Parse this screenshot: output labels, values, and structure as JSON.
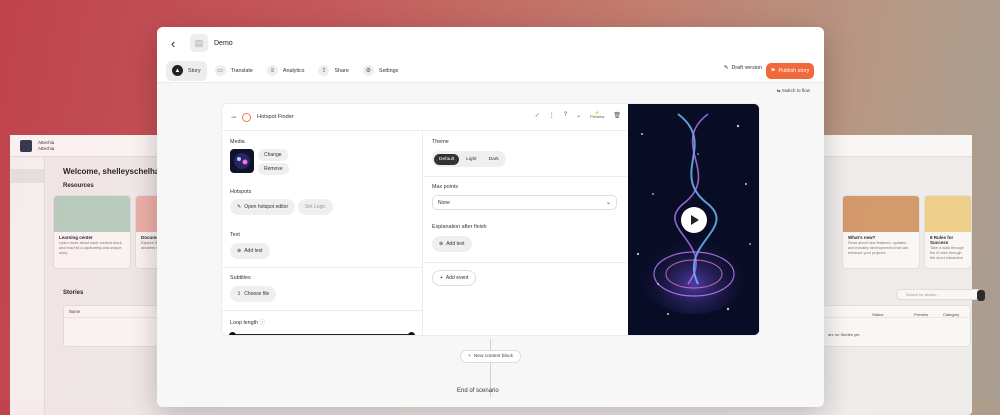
{
  "background_app": {
    "brand": [
      "Attechia",
      "Attechia"
    ],
    "welcome": "Welcome, shelleyschelhaas_work",
    "resources_title": "Resources",
    "cards": [
      {
        "title": "Learning center",
        "desc": "Learn more about each content block and how tell a captivating and unique story.",
        "color": "#b9d6c6"
      },
      {
        "title": "Documentation",
        "desc": "Explore the documentation and find answers to",
        "color": "#f0b9b0"
      },
      {
        "title": "What's new?",
        "desc": "Read about new features, updates, and industry developments that can enhance your projects.",
        "color": "#f2e2d2"
      },
      {
        "title": "8 Rules for Success",
        "desc": "Take a walk through the 8 rules through the short interactive",
        "color": "#f3d48a"
      }
    ],
    "stories_title": "Stories",
    "search_placeholder": "Search for stories...",
    "table_headers": [
      "Name",
      "Status",
      "Preview",
      "Category"
    ],
    "empty_text": "are no Stories yet."
  },
  "window": {
    "title": "Demo",
    "tabs": [
      {
        "label": "Story",
        "icon": "story-icon",
        "active": true
      },
      {
        "label": "Translate",
        "icon": "translate-icon",
        "active": false
      },
      {
        "label": "Analytics",
        "icon": "analytics-icon",
        "active": false
      },
      {
        "label": "Share",
        "icon": "share-icon",
        "active": false
      },
      {
        "label": "Settings",
        "icon": "settings-icon",
        "active": false
      }
    ],
    "draft_label": "Draft version",
    "publish_label": "Publish story",
    "switch_label": "Switch to flow",
    "accent": "#f2683a"
  },
  "editor": {
    "block_name": "Hotspot Finder",
    "preview_label": "Preview",
    "media": {
      "label": "Media",
      "change": "Change",
      "remove": "Remove"
    },
    "hotspots": {
      "label": "Hotspots",
      "open": "Open hotspot editor",
      "logic": "Set Logic"
    },
    "text": {
      "label": "Text",
      "add": "Add text"
    },
    "subtitles": {
      "label": "Subtitles",
      "choose": "Choose file"
    },
    "loop": {
      "label": "Loop length"
    },
    "theme": {
      "label": "Theme",
      "options": [
        "Default",
        "Light",
        "Dark"
      ],
      "selected": "Default"
    },
    "max_points": {
      "label": "Max points",
      "value": "None"
    },
    "explanation": {
      "label": "Explanation after finish",
      "add": "Add text"
    },
    "add_event": "Add event"
  },
  "flow": {
    "new_block": "New content block",
    "end": "End of scenario"
  }
}
